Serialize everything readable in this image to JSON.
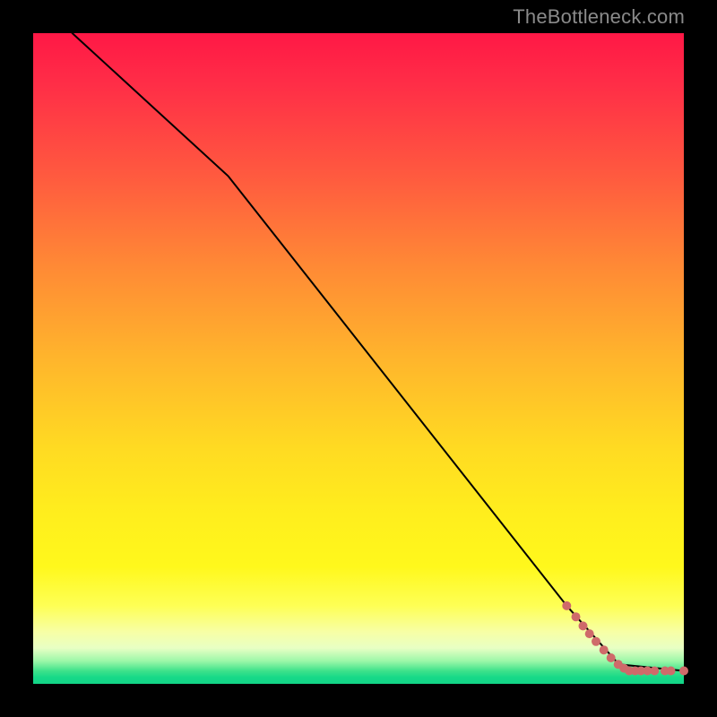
{
  "watermark": "TheBottleneck.com",
  "chart_data": {
    "type": "line",
    "title": "",
    "xlabel": "",
    "ylabel": "",
    "xlim": [
      0,
      100
    ],
    "ylim": [
      0,
      100
    ],
    "series": [
      {
        "name": "curve",
        "x": [
          6,
          30,
          82,
          90,
          100
        ],
        "y": [
          100,
          78,
          12,
          3,
          2
        ],
        "stroke": "#000000",
        "stroke_width": 2
      }
    ],
    "points": {
      "name": "dots",
      "color": "#cf6a6a",
      "radius": 5,
      "data": [
        {
          "x": 82.0,
          "y": 12.0
        },
        {
          "x": 83.4,
          "y": 10.3
        },
        {
          "x": 84.5,
          "y": 8.9
        },
        {
          "x": 85.5,
          "y": 7.7
        },
        {
          "x": 86.5,
          "y": 6.5
        },
        {
          "x": 87.7,
          "y": 5.2
        },
        {
          "x": 88.8,
          "y": 4.0
        },
        {
          "x": 89.9,
          "y": 3.0
        },
        {
          "x": 90.8,
          "y": 2.4
        },
        {
          "x": 91.6,
          "y": 2.0
        },
        {
          "x": 92.5,
          "y": 2.0
        },
        {
          "x": 93.4,
          "y": 2.0
        },
        {
          "x": 94.4,
          "y": 2.0
        },
        {
          "x": 95.5,
          "y": 2.0
        },
        {
          "x": 97.1,
          "y": 2.0
        },
        {
          "x": 98.0,
          "y": 2.0
        },
        {
          "x": 100.0,
          "y": 2.0
        }
      ]
    },
    "background_gradient": [
      {
        "pos": 0.0,
        "color": "#ff1846"
      },
      {
        "pos": 0.5,
        "color": "#ffdb22"
      },
      {
        "pos": 0.82,
        "color": "#fff81c"
      },
      {
        "pos": 0.96,
        "color": "#9cf7a8"
      },
      {
        "pos": 1.0,
        "color": "#13d487"
      }
    ]
  }
}
